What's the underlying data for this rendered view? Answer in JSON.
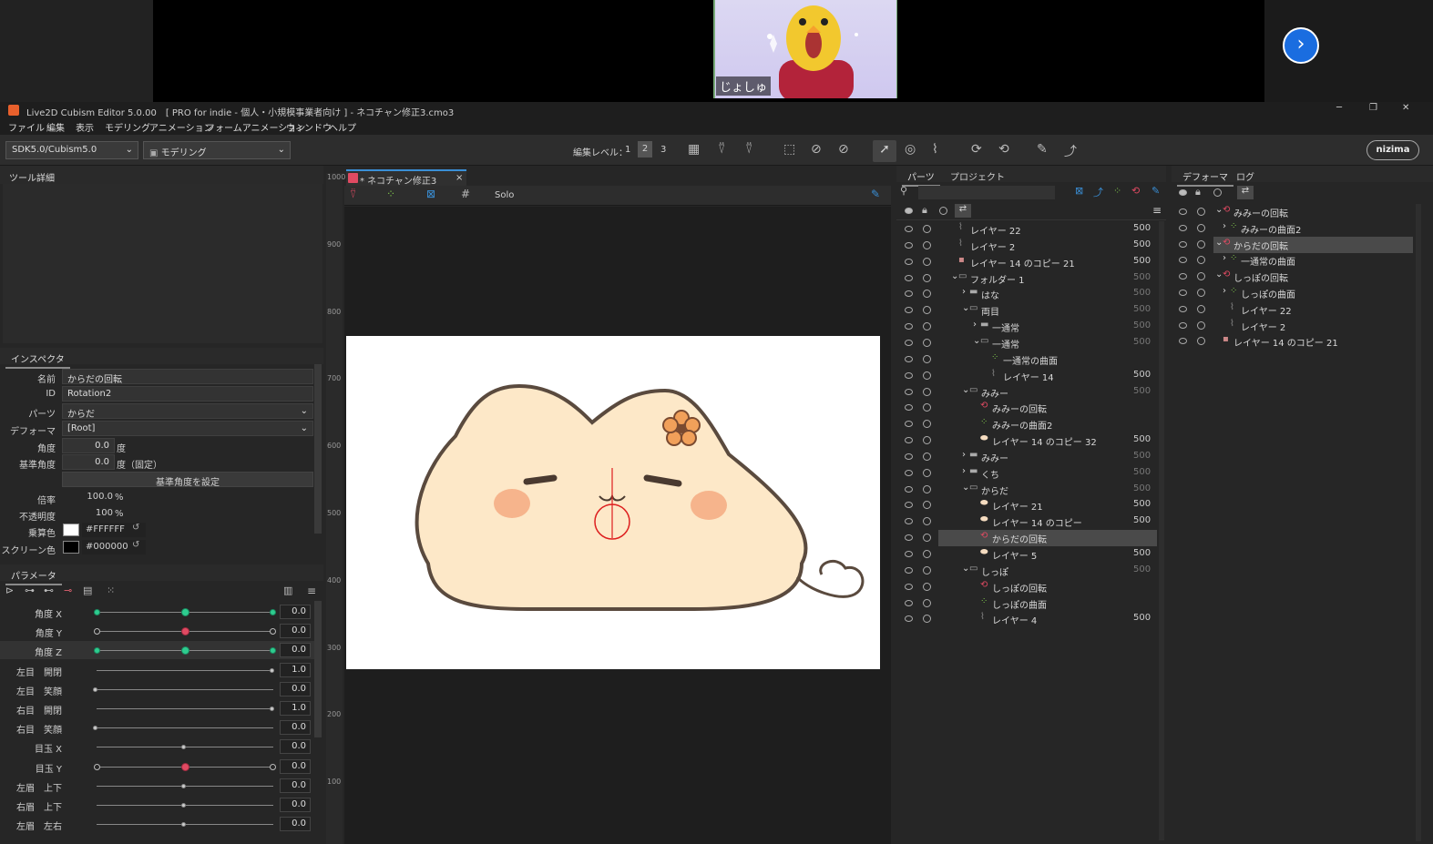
{
  "stream": {
    "cam_label": "じょしゅ"
  },
  "titlebar": {
    "title": "Live2D Cubism Editor 5.0.00　[ PRO for indie - 個人・小規模事業者向け ] - ネコチャン修正3.cmo3",
    "min": "─",
    "max": "❐",
    "close": "✕"
  },
  "menu": [
    "ファイル",
    "編集",
    "表示",
    "モデリング",
    "アニメーション",
    "フォームアニメーション",
    "ウィンドウ",
    "ヘルプ"
  ],
  "toolbar": {
    "sdk": "SDK5.0/Cubism5.0",
    "mode": "モデリング",
    "edit_level_label": "編集レベル：",
    "levels": [
      "1",
      "2",
      "3"
    ],
    "logo": "nizima"
  },
  "tool_detail": {
    "tab": "ツール詳細"
  },
  "inspector": {
    "tab": "インスペクタ",
    "name_label": "名前",
    "name_value": "からだの回転",
    "id_label": "ID",
    "id_value": "Rotation2",
    "parts_label": "パーツ",
    "parts_value": "からだ",
    "deformer_label": "デフォーマ",
    "deformer_value": "[Root]",
    "angle_label": "角度",
    "angle_value": "0.0",
    "angle_unit": "度",
    "base_angle_label": "基準角度",
    "base_angle_value": "0.0",
    "base_angle_unit": "度（固定）",
    "set_base_button": "基準角度を設定",
    "scale_label": "倍率",
    "scale_value": "100.0",
    "scale_unit": "%",
    "opacity_label": "不透明度",
    "opacity_value": "100",
    "opacity_unit": "%",
    "multiply_label": "乗算色",
    "multiply_value": "#FFFFFF",
    "screen_label": "スクリーン色",
    "screen_value": "#000000"
  },
  "params": {
    "tab": "パラメータ",
    "items": [
      {
        "label": "角度 X",
        "value": "0.0",
        "pos": 0.5,
        "style": "g3"
      },
      {
        "label": "角度 Y",
        "value": "0.0",
        "pos": 0.5,
        "style": "r3"
      },
      {
        "label": "角度 Z",
        "value": "0.0",
        "pos": 0.5,
        "style": "g3"
      },
      {
        "label": "左目　開閉",
        "value": "1.0",
        "pos": 1.0,
        "style": "plain"
      },
      {
        "label": "左目　笑顔",
        "value": "0.0",
        "pos": 0.0,
        "style": "plain"
      },
      {
        "label": "右目　開閉",
        "value": "1.0",
        "pos": 1.0,
        "style": "plain"
      },
      {
        "label": "右目　笑顔",
        "value": "0.0",
        "pos": 0.0,
        "style": "plain"
      },
      {
        "label": "目玉 X",
        "value": "0.0",
        "pos": 0.5,
        "style": "plain"
      },
      {
        "label": "目玉 Y",
        "value": "0.0",
        "pos": 0.5,
        "style": "r3"
      },
      {
        "label": "左眉　上下",
        "value": "0.0",
        "pos": 0.5,
        "style": "plain"
      },
      {
        "label": "右眉　上下",
        "value": "0.0",
        "pos": 0.5,
        "style": "plain"
      },
      {
        "label": "左眉　左右",
        "value": "0.0",
        "pos": 0.5,
        "style": "plain"
      }
    ]
  },
  "canvas": {
    "tab": "* ネコチャン修正3",
    "solo": "Solo",
    "ruler": [
      "1000",
      "900",
      "800",
      "700",
      "600",
      "500",
      "400",
      "300",
      "200",
      "100"
    ]
  },
  "parts_panel": {
    "tabs": [
      "パーツ",
      "プロジェクト"
    ],
    "rows": [
      {
        "name": "レイヤー 22",
        "indent": 1,
        "type": "line",
        "val": "500",
        "dim": false
      },
      {
        "name": "レイヤー 2",
        "indent": 1,
        "type": "line",
        "val": "500",
        "dim": false
      },
      {
        "name": "レイヤー 14 のコピー 21",
        "indent": 1,
        "type": "img",
        "val": "500",
        "dim": false
      },
      {
        "name": "フォルダー 1",
        "indent": 1,
        "type": "folder-open",
        "val": "500",
        "dim": true
      },
      {
        "name": "はな",
        "indent": 2,
        "type": "folder",
        "val": "500",
        "dim": true
      },
      {
        "name": "両目",
        "indent": 2,
        "type": "folder-open",
        "val": "500",
        "dim": true
      },
      {
        "name": "一通常",
        "indent": 3,
        "type": "folder",
        "val": "500",
        "dim": true
      },
      {
        "name": "一通常",
        "indent": 3,
        "type": "folder-open",
        "val": "500",
        "dim": true
      },
      {
        "name": "一通常の曲面",
        "indent": 4,
        "type": "warp",
        "val": "",
        "dim": false
      },
      {
        "name": "レイヤー 14",
        "indent": 4,
        "type": "line",
        "val": "500",
        "dim": false
      },
      {
        "name": "みみー",
        "indent": 2,
        "type": "folder-open",
        "val": "500",
        "dim": true
      },
      {
        "name": "みみーの回転",
        "indent": 3,
        "type": "rot",
        "val": "",
        "dim": false
      },
      {
        "name": "みみーの曲面2",
        "indent": 3,
        "type": "warp",
        "val": "",
        "dim": false
      },
      {
        "name": "レイヤー 14 のコピー 32",
        "indent": 3,
        "type": "blob",
        "val": "500",
        "dim": false
      },
      {
        "name": "みみー",
        "indent": 2,
        "type": "folder",
        "val": "500",
        "dim": true
      },
      {
        "name": "くち",
        "indent": 2,
        "type": "folder",
        "val": "500",
        "dim": true
      },
      {
        "name": "からだ",
        "indent": 2,
        "type": "folder-open",
        "val": "500",
        "dim": true
      },
      {
        "name": "レイヤー 21",
        "indent": 3,
        "type": "blob",
        "val": "500",
        "dim": false
      },
      {
        "name": "レイヤー 14 のコピー",
        "indent": 3,
        "type": "blob",
        "val": "500",
        "dim": false
      },
      {
        "name": "からだの回転",
        "indent": 3,
        "type": "rot",
        "val": "",
        "dim": false,
        "selected": true
      },
      {
        "name": "レイヤー 5",
        "indent": 3,
        "type": "blob",
        "val": "500",
        "dim": false
      },
      {
        "name": "しっぽ",
        "indent": 2,
        "type": "folder-open",
        "val": "500",
        "dim": true
      },
      {
        "name": "しっぽの回転",
        "indent": 3,
        "type": "rot",
        "val": "",
        "dim": false
      },
      {
        "name": "しっぽの曲面",
        "indent": 3,
        "type": "warp",
        "val": "",
        "dim": false
      },
      {
        "name": "レイヤー 4",
        "indent": 3,
        "type": "line",
        "val": "500",
        "dim": false
      }
    ]
  },
  "deformer_panel": {
    "tabs": [
      "デフォーマ",
      "ログ"
    ],
    "rows": [
      {
        "name": "みみーの回転",
        "indent": 0,
        "type": "rot",
        "arrow": "v"
      },
      {
        "name": "みみーの曲面2",
        "indent": 1,
        "type": "warp",
        "arrow": ">"
      },
      {
        "name": "からだの回転",
        "indent": 0,
        "type": "rot",
        "arrow": "v",
        "selected": true
      },
      {
        "name": "一通常の曲面",
        "indent": 1,
        "type": "warp",
        "arrow": ">"
      },
      {
        "name": "しっぽの回転",
        "indent": 0,
        "type": "rot",
        "arrow": "v"
      },
      {
        "name": "しっぽの曲面",
        "indent": 1,
        "type": "warp",
        "arrow": ">"
      },
      {
        "name": "レイヤー 22",
        "indent": 1,
        "type": "line",
        "arrow": ""
      },
      {
        "name": "レイヤー 2",
        "indent": 1,
        "type": "line",
        "arrow": ""
      },
      {
        "name": "レイヤー 14 のコピー 21",
        "indent": 0,
        "type": "img",
        "arrow": ""
      }
    ]
  },
  "colors": {
    "accent": "#1a6de0",
    "rotation": "#e04a62",
    "warp": "#7cc04a",
    "knob_green": "#2ecc8f"
  }
}
